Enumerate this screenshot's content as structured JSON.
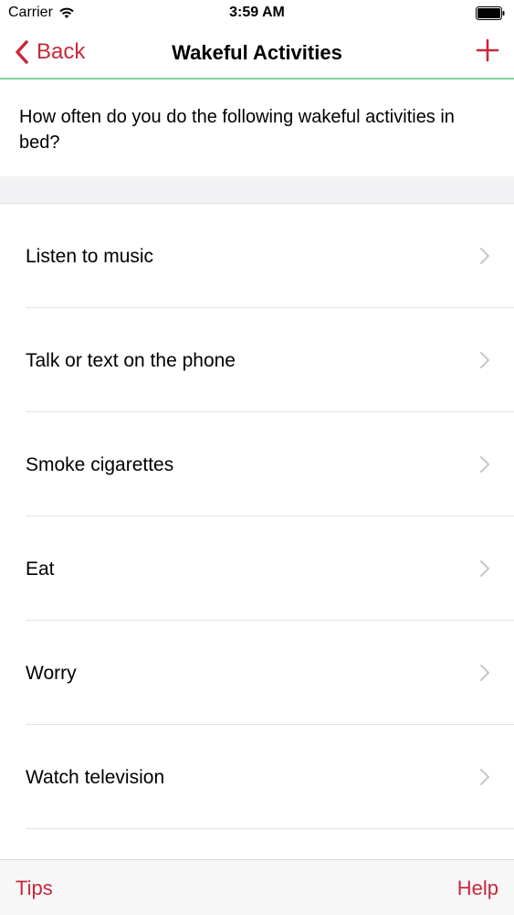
{
  "status_bar": {
    "carrier": "Carrier",
    "time": "3:59 AM",
    "wifi_icon": "wifi-icon",
    "battery_icon": "battery-icon"
  },
  "nav": {
    "back_label": "Back",
    "title": "Wakeful Activities",
    "add_icon": "plus-icon",
    "back_icon": "chevron-left-icon"
  },
  "question": {
    "text": "How often do you do the following wakeful activities in bed?"
  },
  "activities": [
    {
      "label": "Listen to music"
    },
    {
      "label": "Talk or text on the phone"
    },
    {
      "label": "Smoke cigarettes"
    },
    {
      "label": "Eat"
    },
    {
      "label": "Worry"
    },
    {
      "label": "Watch television"
    }
  ],
  "toolbar": {
    "tips_label": "Tips",
    "help_label": "Help"
  },
  "colors": {
    "accent": "#c8283a",
    "nav_border": "#7fd3a0",
    "chevron": "#c7c7cc"
  }
}
